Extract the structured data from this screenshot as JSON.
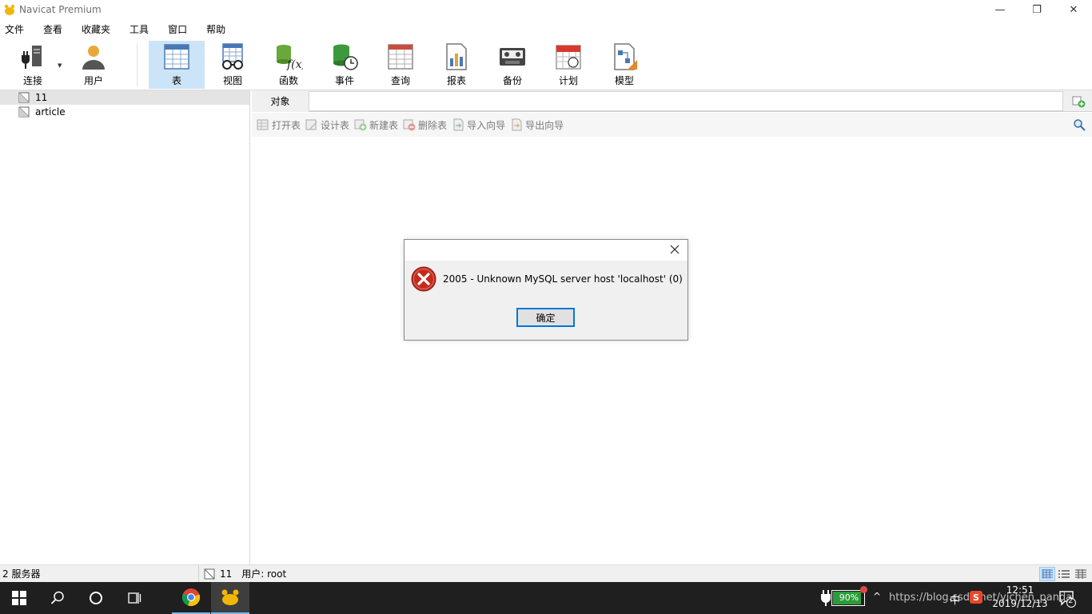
{
  "window": {
    "title": "Navicat Premium",
    "controls": {
      "minimize": "—",
      "restore": "❐",
      "close": "✕"
    }
  },
  "menu": [
    "文件",
    "查看",
    "收藏夹",
    "工具",
    "窗口",
    "帮助"
  ],
  "toolbar": {
    "buttons": [
      {
        "label": "连接",
        "icon": "plug-server-icon"
      },
      {
        "label": "用户",
        "icon": "user-icon"
      },
      {
        "label": "表",
        "icon": "table-icon",
        "active": true
      },
      {
        "label": "视图",
        "icon": "view-glasses-icon"
      },
      {
        "label": "函数",
        "icon": "function-icon"
      },
      {
        "label": "事件",
        "icon": "event-clock-icon"
      },
      {
        "label": "查询",
        "icon": "query-icon"
      },
      {
        "label": "报表",
        "icon": "report-icon"
      },
      {
        "label": "备份",
        "icon": "backup-icon"
      },
      {
        "label": "计划",
        "icon": "calendar-icon"
      },
      {
        "label": "模型",
        "icon": "model-icon"
      }
    ]
  },
  "tree": {
    "items": [
      {
        "label": "11",
        "selected": true
      },
      {
        "label": "article",
        "selected": false
      }
    ]
  },
  "tabs": {
    "objects_label": "对象"
  },
  "objectbar": {
    "items": [
      "打开表",
      "设计表",
      "新建表",
      "删除表",
      "导入向导",
      "导出向导"
    ]
  },
  "dialog": {
    "message": "2005 - Unknown MySQL server host 'localhost' (0)",
    "ok_label": "确定"
  },
  "statusbar": {
    "servers": "2 服务器",
    "connection": "11",
    "user": "用户: root"
  },
  "taskbar": {
    "battery": "90%",
    "time": "12:51",
    "date": "2019/12/13",
    "notifications": "2",
    "watermark": "https://blog.csdn.net/yichen_panda",
    "tray_ime": "中"
  },
  "colors": {
    "accent": "#0078d7",
    "toolbar_active": "#cce4f7",
    "error_red": "#c42b1c",
    "taskbar": "#1f1f1f"
  }
}
